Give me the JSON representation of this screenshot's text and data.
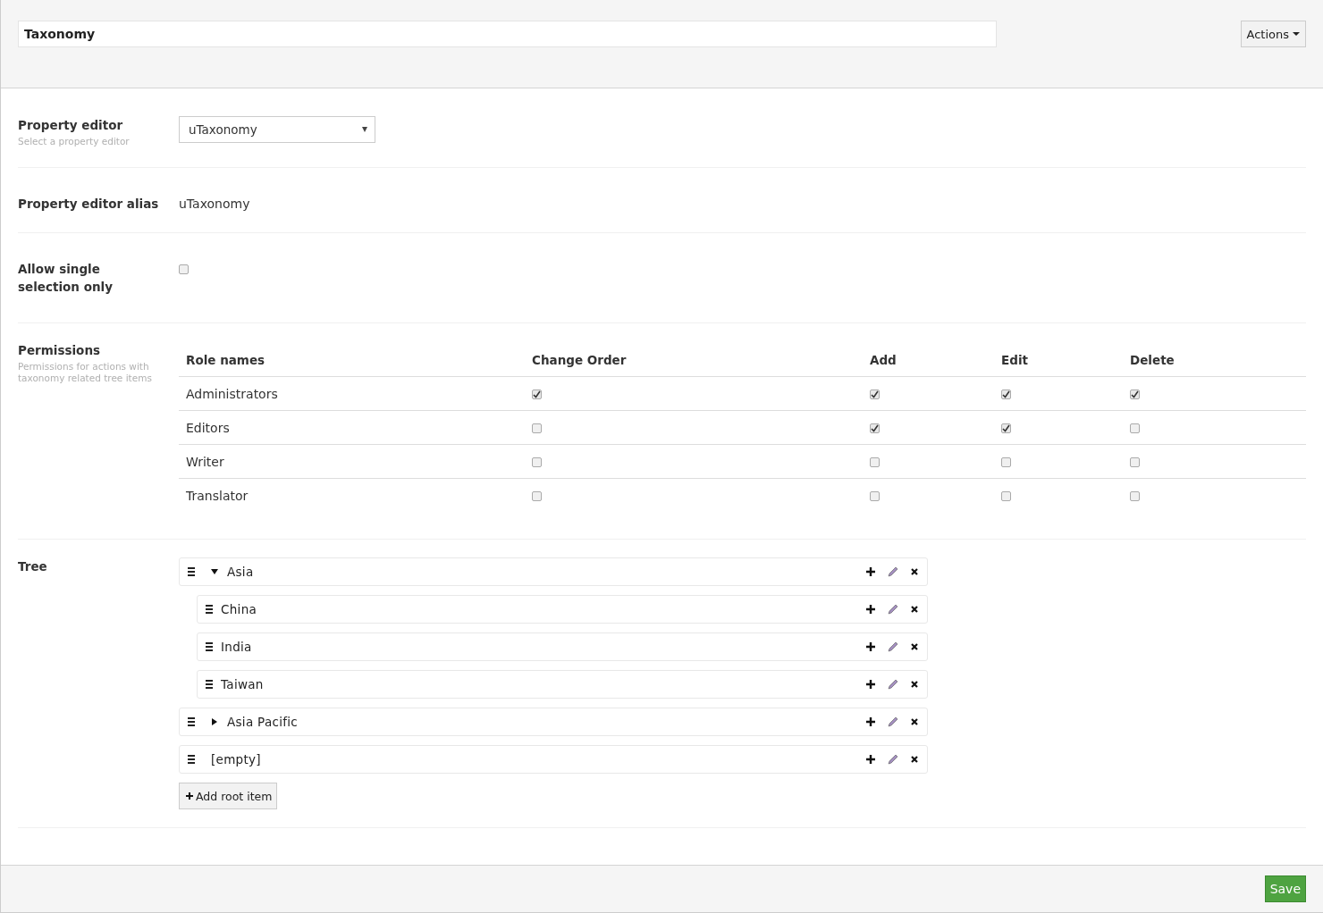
{
  "header": {
    "name_value": "Taxonomy",
    "actions_button": "Actions"
  },
  "properties": [
    {
      "kind": "select",
      "label": "Property editor",
      "description": "Select a property editor",
      "value": "uTaxonomy"
    },
    {
      "kind": "text",
      "label": "Property editor alias",
      "value": "uTaxonomy"
    },
    {
      "kind": "checkbox",
      "label": "Allow single selection only",
      "checked": false
    }
  ],
  "permissions": {
    "label": "Permissions",
    "description": "Permissions for actions with taxonomy related tree items",
    "columns": [
      "Role names",
      "Change Order",
      "Add",
      "Edit",
      "Delete"
    ],
    "rows": [
      {
        "role": "Administrators",
        "checks": [
          true,
          true,
          true,
          true
        ]
      },
      {
        "role": "Editors",
        "checks": [
          false,
          true,
          true,
          false
        ]
      },
      {
        "role": "Writer",
        "checks": [
          false,
          false,
          false,
          false
        ]
      },
      {
        "role": "Translator",
        "checks": [
          false,
          false,
          false,
          false
        ]
      }
    ]
  },
  "tree": {
    "label": "Tree",
    "add_root_button": "Add root item",
    "items": [
      {
        "name": "Asia",
        "expanded": true,
        "children": [
          {
            "name": "China"
          },
          {
            "name": "India"
          },
          {
            "name": "Taiwan"
          }
        ]
      },
      {
        "name": "Asia Pacific",
        "expanded": false
      },
      {
        "name": "[empty]"
      }
    ]
  },
  "footer": {
    "save_button": "Save"
  }
}
